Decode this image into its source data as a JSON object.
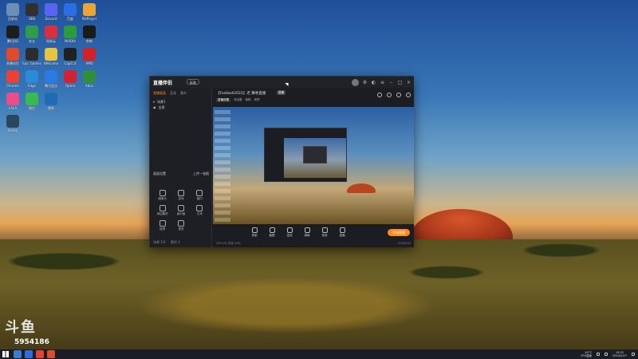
{
  "desktop": {
    "icons": [
      {
        "label": "回收站",
        "color": "#6c8fb7"
      },
      {
        "label": "腾讯QQ",
        "color": "#1d1d1d"
      },
      {
        "label": "直播伴侣",
        "color": "#e04b2b"
      },
      {
        "label": "Chrome",
        "color": "#e94235"
      },
      {
        "label": "LALA",
        "color": "#ec4b8c"
      },
      {
        "label": "Steam",
        "color": "#2a475e"
      },
      {
        "label": "OBS",
        "color": "#303030"
      },
      {
        "label": "安全",
        "color": "#2d9c4c"
      },
      {
        "label": "Epic Games",
        "color": "#2d2d2d"
      },
      {
        "label": "Edge",
        "color": "#2a8bd8"
      },
      {
        "label": "微信",
        "color": "#3bb84f"
      },
      {
        "label": "Discord",
        "color": "#5865f2"
      },
      {
        "label": "网易云",
        "color": "#d9303f"
      },
      {
        "label": "WeGame",
        "color": "#e7c43f"
      },
      {
        "label": "腾讯会议",
        "color": "#2a7ae4"
      },
      {
        "label": "雷神",
        "color": "#1f6bb5"
      },
      {
        "label": "百度",
        "color": "#2b6de3"
      },
      {
        "label": "NVIDIA",
        "color": "#2a9d3a"
      },
      {
        "label": "CapCut",
        "color": "#202020"
      },
      {
        "label": "Opera",
        "color": "#d22234"
      },
      {
        "label": "PotPlayer",
        "color": "#e8a53a"
      },
      {
        "label": "剪映",
        "color": "#1a1a1a"
      },
      {
        "label": "AMD",
        "color": "#d42027"
      },
      {
        "label": "Xbox",
        "color": "#2f8f3b"
      }
    ]
  },
  "watermark": {
    "number": "5954186"
  },
  "window": {
    "logo": "直播伴侣",
    "badge": "标准",
    "sidebar": {
      "tabs": [
        "直播画面",
        "互动",
        "观众"
      ],
      "active_tab": 0,
      "rows": [
        "场景1",
        "全屏"
      ],
      "mid_rows": [
        {
          "left": "画面设置",
          "right": "上传一张图"
        }
      ],
      "tools": [
        {
          "label": "摄像头"
        },
        {
          "label": "游戏"
        },
        {
          "label": "窗口"
        },
        {
          "label": "添加素材"
        },
        {
          "label": "画中画"
        },
        {
          "label": "文本"
        },
        {
          "label": "投屏"
        },
        {
          "label": "更多"
        }
      ],
      "footer": [
        "场景 1/5",
        "素材 3"
      ]
    },
    "scene": {
      "title": "【Football2022】老 赛季直播",
      "tag": "直播",
      "sub_tabs": [
        "直播设置",
        "流设置",
        "美颜",
        "滤镜"
      ],
      "active_sub": 0
    },
    "controls": [
      {
        "label": "录制"
      },
      {
        "label": "截图"
      },
      {
        "label": "连线"
      },
      {
        "label": "弹幕"
      },
      {
        "label": "音效"
      },
      {
        "label": "直播"
      }
    ],
    "live_button": "开始直播",
    "footer_left": "CPU 0%  内存 10%",
    "footer_right": "00:00:00"
  },
  "taskbar": {
    "apps": [
      {
        "color": "#3a7bd5"
      },
      {
        "color": "#2b6de3"
      },
      {
        "color": "#e94235"
      },
      {
        "color": "#e04b2b"
      }
    ],
    "temp": "40°C",
    "temp_sub": "CPU温度",
    "time": "19:52",
    "date": "2024/2/27"
  }
}
